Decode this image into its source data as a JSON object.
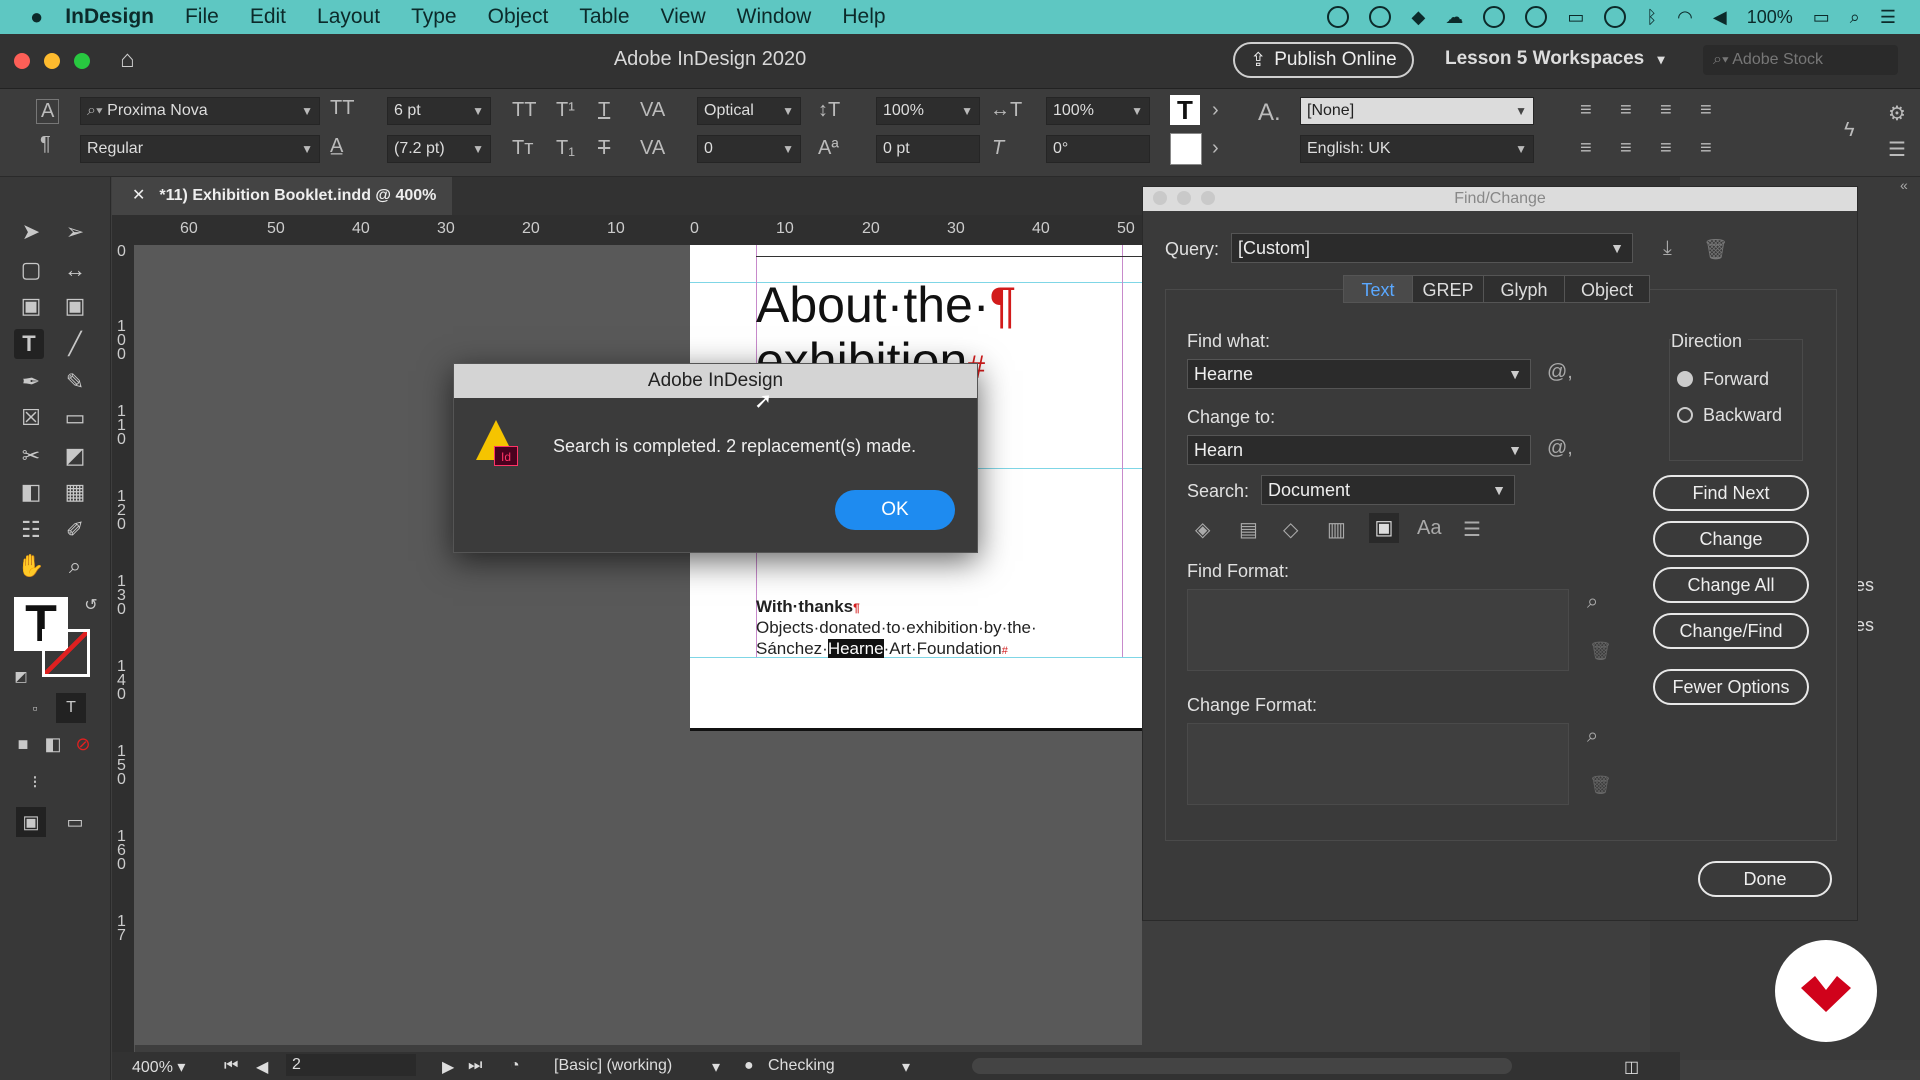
{
  "menubar": {
    "apple": "",
    "app": "InDesign",
    "items": [
      "File",
      "Edit",
      "Layout",
      "Type",
      "Object",
      "Table",
      "View",
      "Window",
      "Help"
    ],
    "battery": "100%"
  },
  "titlebar": {
    "title": "Adobe InDesign 2020",
    "publish": "Publish Online",
    "workspace": "Lesson 5 Workspaces",
    "stock_placeholder": "Adobe Stock"
  },
  "control": {
    "font": "Proxima Nova",
    "style": "Regular",
    "size": "6 pt",
    "leading": "(7.2 pt)",
    "kerning": "Optical",
    "tracking": "0",
    "vscale": "100%",
    "hscale": "100%",
    "baseline": "0 pt",
    "skew": "0°",
    "char_style": "[None]",
    "language": "English: UK"
  },
  "document": {
    "tab": "*11) Exhibition Booklet.indd @ 400%",
    "heading_line1": "About·the·",
    "heading_line2": "exhibition",
    "pilcrow": "¶",
    "hash": "#",
    "thanks": "With·thanks",
    "body1": "Objects·donated·to·exhibition·by·the·",
    "body2a": "Sánchez·",
    "body2_highlight": "Hearne",
    "body2b": "·Art·Foundation",
    "ruler_h": [
      "60",
      "50",
      "40",
      "30",
      "20",
      "10",
      "0",
      "10",
      "20",
      "30",
      "40",
      "50"
    ],
    "ruler_v": [
      "0",
      "1 0 0",
      "1 1 0",
      "1 2 0",
      "1 3 0",
      "1 4 0",
      "1 5 0",
      "1 6 0",
      "1 7"
    ]
  },
  "status": {
    "zoom": "400%",
    "page": "2",
    "mode": "[Basic] (working)",
    "preflight": "Checking"
  },
  "find_dialog": {
    "title": "Find/Change",
    "query_label": "Query:",
    "query_value": "[Custom]",
    "tabs": [
      "Text",
      "GREP",
      "Glyph",
      "Object"
    ],
    "find_what_label": "Find what:",
    "find_what_value": "Hearne",
    "change_to_label": "Change to:",
    "change_to_value": "Hearn",
    "search_label": "Search:",
    "search_value": "Document",
    "direction_label": "Direction",
    "forward": "Forward",
    "backward": "Backward",
    "find_format_label": "Find Format:",
    "change_format_label": "Change Format:",
    "buttons": [
      "Find Next",
      "Change",
      "Change All",
      "Change/Find",
      "Fewer Options"
    ],
    "done": "Done",
    "option_icons": [
      "Aa"
    ]
  },
  "alert": {
    "title": "Adobe InDesign",
    "message": "Search is completed.  2 replacement(s) made.",
    "ok": "OK",
    "icon_text": "Id"
  },
  "panel_text": [
    "es",
    "es"
  ]
}
